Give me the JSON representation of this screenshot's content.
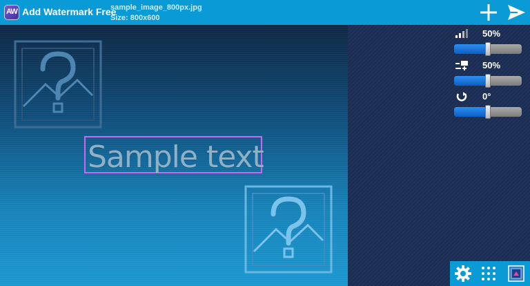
{
  "header": {
    "app_title": "Add Watermark Free",
    "logo_text": "AW",
    "file_name": "sample_image_800px.jpg",
    "file_size": "Size: 800x600",
    "add_icon": "plus-icon",
    "send_icon": "send-icon"
  },
  "canvas": {
    "watermark_text": "Sample text",
    "selection_color": "#d663f0",
    "placeholder_icon": "image-placeholder-icon"
  },
  "controls": {
    "opacity": {
      "icon": "opacity-icon",
      "value_label": "50%",
      "value": 0.5
    },
    "size": {
      "icon": "size-icon",
      "value_label": "50%",
      "value": 0.5
    },
    "rotation": {
      "icon": "rotate-icon",
      "value_label": "0°",
      "value": 0.5
    }
  },
  "bottom_bar": {
    "settings_icon": "gear-icon",
    "grid_icon": "grid-icon",
    "layers_icon": "layers-icon"
  },
  "colors": {
    "accent": "#0a9ad6",
    "panel": "#1d2f55",
    "slider_fill": "#1478e0"
  }
}
